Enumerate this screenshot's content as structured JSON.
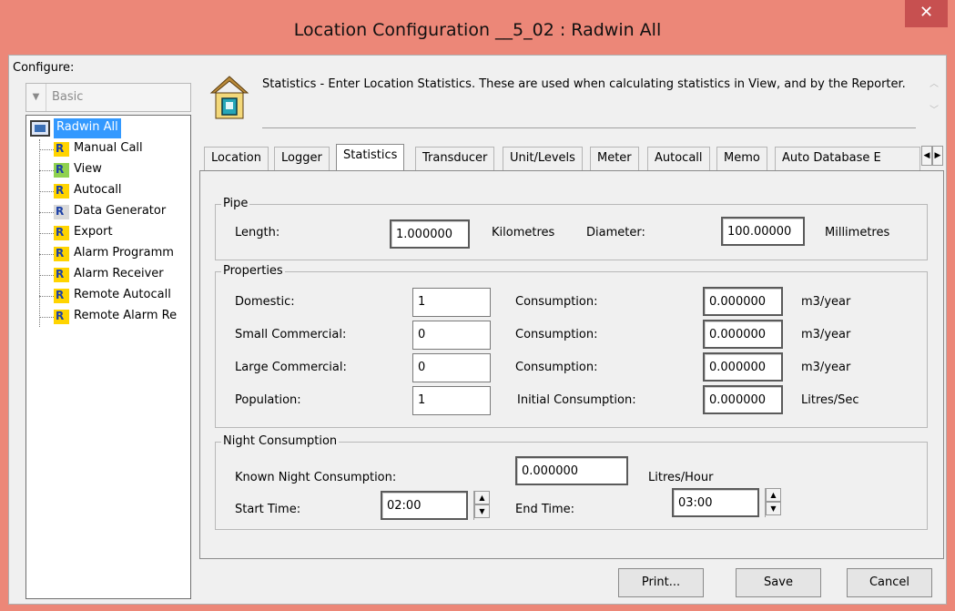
{
  "window": {
    "title": "Location Configuration __5_02 : Radwin All",
    "close_symbol": "✕"
  },
  "sidebar": {
    "configure_label": "Configure:",
    "profile_select_value": "Basic",
    "tree_root": "Radwin All",
    "tree_items": [
      {
        "label": "Manual Call",
        "icon": "manual-call-icon"
      },
      {
        "label": "View",
        "icon": "view-icon"
      },
      {
        "label": "Autocall",
        "icon": "autocall-icon"
      },
      {
        "label": "Data Generator",
        "icon": "data-generator-icon"
      },
      {
        "label": "Export",
        "icon": "export-icon"
      },
      {
        "label": "Alarm Programm",
        "icon": "alarm-program-icon"
      },
      {
        "label": "Alarm Receiver",
        "icon": "alarm-receiver-icon"
      },
      {
        "label": "Remote Autocall",
        "icon": "remote-autocall-icon"
      },
      {
        "label": "Remote Alarm Re",
        "icon": "remote-alarm-icon"
      }
    ]
  },
  "header": {
    "description": "Statistics - Enter Location Statistics. These are used when calculating statistics in View, and by the Reporter."
  },
  "tabs": [
    "Location",
    "Logger",
    "Statistics",
    "Transducer",
    "Unit/Levels",
    "Meter",
    "Autocall",
    "Memo",
    "Auto Database E"
  ],
  "active_tab": "Statistics",
  "pipe": {
    "title": "Pipe",
    "length_label": "Length:",
    "length_value": "1.000000",
    "length_unit": "Kilometres",
    "diameter_label": "Diameter:",
    "diameter_value": "100.00000",
    "diameter_unit": "Millimetres"
  },
  "properties": {
    "title": "Properties",
    "rows": [
      {
        "label": "Domestic:",
        "value": "1",
        "consumption_label": "Consumption:",
        "consumption_value": "0.000000",
        "unit": "m3/year"
      },
      {
        "label": "Small Commercial:",
        "value": "0",
        "consumption_label": "Consumption:",
        "consumption_value": "0.000000",
        "unit": "m3/year"
      },
      {
        "label": "Large Commercial:",
        "value": "0",
        "consumption_label": "Consumption:",
        "consumption_value": "0.000000",
        "unit": "m3/year"
      },
      {
        "label": "Population:",
        "value": "1",
        "consumption_label": "Initial Consumption:",
        "consumption_value": "0.000000",
        "unit": "Litres/Sec"
      }
    ]
  },
  "night": {
    "title": "Night Consumption",
    "known_label": "Known Night Consumption:",
    "known_value": "0.000000",
    "known_unit": "Litres/Hour",
    "start_label": "Start Time:",
    "start_value": "02:00",
    "end_label": "End Time:",
    "end_value": "03:00"
  },
  "buttons": {
    "print": "Print...",
    "save": "Save",
    "cancel": "Cancel"
  }
}
